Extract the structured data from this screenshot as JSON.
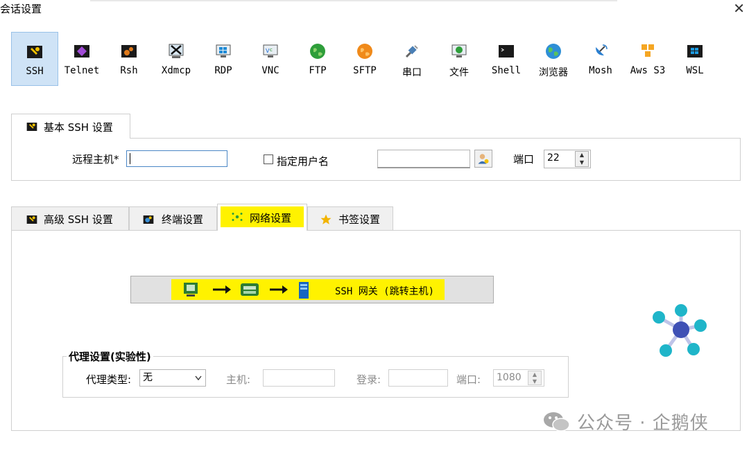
{
  "window": {
    "title": "会话设置",
    "close_glyph": "✕"
  },
  "session_types": [
    {
      "label": "SSH",
      "icon": "wrench-icon",
      "active": true
    },
    {
      "label": "Telnet",
      "icon": "telnet-icon"
    },
    {
      "label": "Rsh",
      "icon": "rsh-icon"
    },
    {
      "label": "Xdmcp",
      "icon": "xdmcp-icon"
    },
    {
      "label": "RDP",
      "icon": "rdp-monitor-icon"
    },
    {
      "label": "VNC",
      "icon": "vnc-icon"
    },
    {
      "label": "FTP",
      "icon": "ftp-globe-icon"
    },
    {
      "label": "SFTP",
      "icon": "sftp-icon"
    },
    {
      "label": "串口",
      "icon": "serial-plug-icon"
    },
    {
      "label": "文件",
      "icon": "file-monitor-icon"
    },
    {
      "label": "Shell",
      "icon": "shell-terminal-icon"
    },
    {
      "label": "浏览器",
      "icon": "browser-globe-icon"
    },
    {
      "label": "Mosh",
      "icon": "satellite-icon"
    },
    {
      "label": "Aws S3",
      "icon": "aws-s3-icon"
    },
    {
      "label": "WSL",
      "icon": "windows-icon"
    }
  ],
  "basic": {
    "tab_label": "基本 SSH 设置",
    "remote_host_label": "远程主机*",
    "remote_host_value": "",
    "specify_username_label": "指定用户名",
    "specify_username_checked": false,
    "username_value": "",
    "port_label": "端口",
    "port_value": "22"
  },
  "advanced_tabs": [
    {
      "label": "高级 SSH 设置",
      "icon": "wrench-icon"
    },
    {
      "label": "终端设置",
      "icon": "terminal-settings-icon"
    },
    {
      "label": "网络设置",
      "icon": "network-icon",
      "active": true
    },
    {
      "label": "书签设置",
      "icon": "star-icon"
    }
  ],
  "network": {
    "gateway_label": "SSH 网关 (跳转主机)",
    "proxy": {
      "group_title": "代理设置(实验性)",
      "type_label": "代理类型:",
      "type_value": "无",
      "host_label": "主机:",
      "host_value": "",
      "login_label": "登录:",
      "login_value": "",
      "port_label": "端口:",
      "port_value": "1080"
    }
  },
  "watermark": "公众号 · 企鹅侠",
  "colors": {
    "highlight": "#fff200",
    "active_tab_bg": "#cfe3f6",
    "network_node": "#1fb5c9",
    "network_center": "#3f51b5"
  }
}
